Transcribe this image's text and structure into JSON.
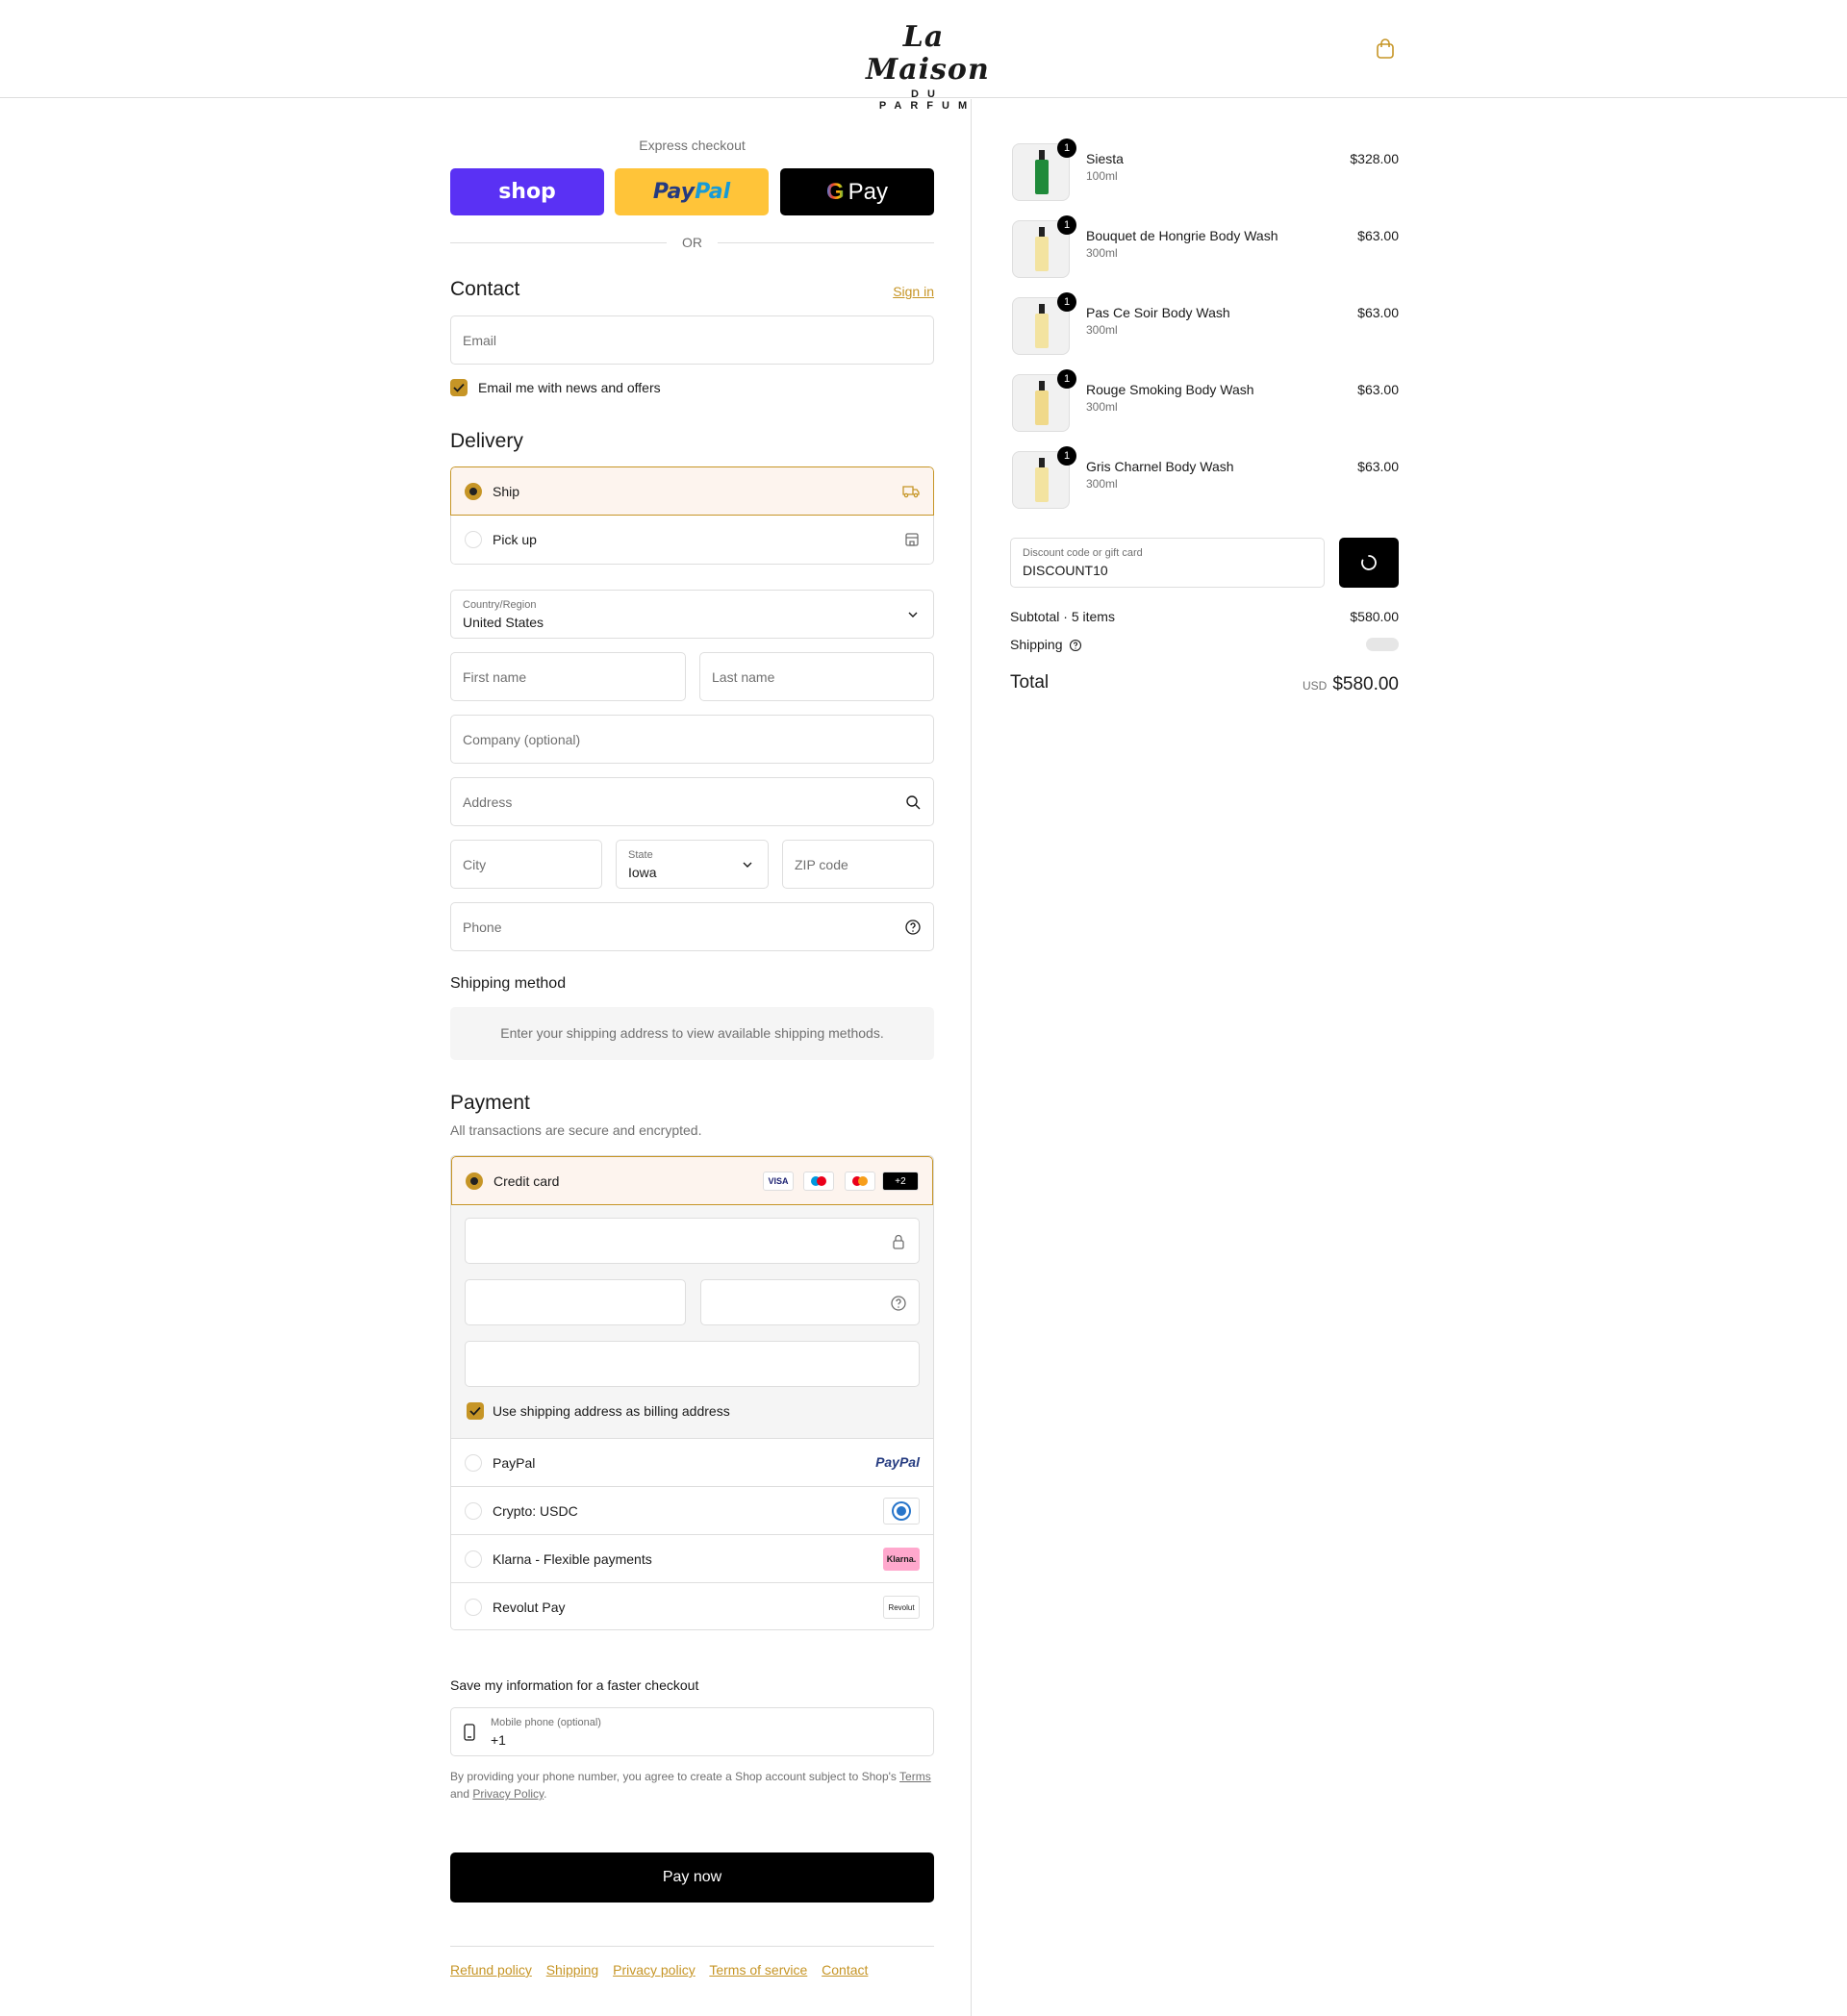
{
  "header": {
    "logo_script": "La Maison",
    "logo_sub": "DU PARFUM"
  },
  "express": {
    "label": "Express checkout",
    "shop": "shop",
    "paypal_a": "Pay",
    "paypal_b": "Pal",
    "gpay": "Pay",
    "or": "OR"
  },
  "contact": {
    "title": "Contact",
    "signin": "Sign in",
    "email_placeholder": "Email",
    "news_label": "Email me with news and offers"
  },
  "delivery": {
    "title": "Delivery",
    "options": [
      {
        "label": "Ship"
      },
      {
        "label": "Pick up"
      }
    ],
    "country_label": "Country/Region",
    "country_value": "United States",
    "first_name": "First name",
    "last_name": "Last name",
    "company": "Company (optional)",
    "address": "Address",
    "city": "City",
    "state_label": "State",
    "state_value": "Iowa",
    "zip": "ZIP code",
    "phone": "Phone"
  },
  "shipping_method": {
    "title": "Shipping method",
    "note": "Enter your shipping address to view available shipping methods."
  },
  "payment": {
    "title": "Payment",
    "subtitle": "All transactions are secure and encrypted.",
    "credit_card": "Credit card",
    "brands": [
      "VISA",
      "+2"
    ],
    "billing_label": "Use shipping address as billing address",
    "methods": [
      {
        "label": "PayPal",
        "logo": "PayPal"
      },
      {
        "label": "Crypto: USDC",
        "logo": ""
      },
      {
        "label": "Klarna - Flexible payments",
        "logo": "Klarna."
      },
      {
        "label": "Revolut Pay",
        "logo": "Revolut"
      }
    ]
  },
  "save_info": {
    "title": "Save my information for a faster checkout",
    "phone_label": "Mobile phone (optional)",
    "phone_value": "+1",
    "fine_1": "By providing your phone number, you agree to create a Shop account subject to Shop's",
    "terms": "Terms",
    "fine_2": "and",
    "privacy": "Privacy Policy",
    "fine_3": "."
  },
  "pay_now": "Pay now",
  "footer": {
    "links": [
      "Refund policy",
      "Shipping",
      "Privacy policy",
      "Terms of service",
      "Contact"
    ]
  },
  "summary": {
    "items": [
      {
        "name": "Siesta",
        "size": "100ml",
        "price": "$328.00",
        "qty": "1",
        "color": "#1f8a3a"
      },
      {
        "name": "Bouquet de Hongrie Body Wash",
        "size": "300ml",
        "price": "$63.00",
        "qty": "1",
        "color": "#f3e3a0"
      },
      {
        "name": "Pas Ce Soir Body Wash",
        "size": "300ml",
        "price": "$63.00",
        "qty": "1",
        "color": "#f3e3a0"
      },
      {
        "name": "Rouge Smoking Body Wash",
        "size": "300ml",
        "price": "$63.00",
        "qty": "1",
        "color": "#f0d98a"
      },
      {
        "name": "Gris Charnel Body Wash",
        "size": "300ml",
        "price": "$63.00",
        "qty": "1",
        "color": "#f3e3a0"
      }
    ],
    "discount_label": "Discount code or gift card",
    "discount_value": "DISCOUNT10",
    "subtotal_label": "Subtotal · 5 items",
    "subtotal_value": "$580.00",
    "shipping_label": "Shipping",
    "total_label": "Total",
    "currency": "USD",
    "total_value": "$580.00"
  },
  "colors": {
    "accent": "#c69526",
    "shop": "#5a31f4",
    "paypal": "#ffc439"
  }
}
